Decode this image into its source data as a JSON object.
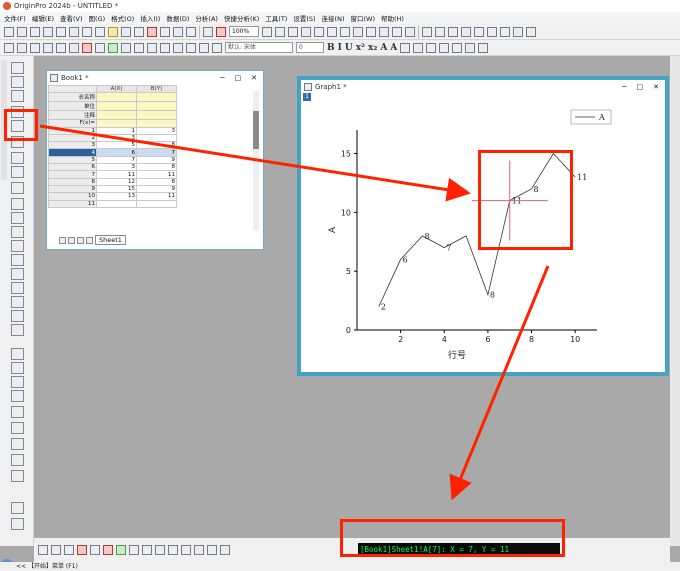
{
  "app": {
    "title": "OriginPro 2024b - UNTITLED *"
  },
  "menu": [
    "文件(F)",
    "编辑(E)",
    "查看(V)",
    "图(G)",
    "格式(O)",
    "插入(I)",
    "数据(D)",
    "分析(A)",
    "快捷分析(K)",
    "工具(T)",
    "设置(S)",
    "连接(N)",
    "窗口(W)",
    "帮助(H)"
  ],
  "toolbar": {
    "zoom": "100%",
    "font_placeholder": "默认: 宋体",
    "font_size": "0",
    "format_buttons": [
      "B",
      "I",
      "U",
      "x²",
      "x₂",
      "A",
      "A"
    ]
  },
  "book": {
    "title": "Book1 *",
    "sheet_tab": "Sheet1",
    "col_headers": [
      "",
      "A(X)",
      "B(Y)"
    ],
    "meta_rows": [
      "长名称",
      "单位",
      "注释",
      "F(x)="
    ],
    "rows": [
      {
        "n": "1",
        "a": "1",
        "b": "3"
      },
      {
        "n": "2",
        "a": "3",
        "b": ""
      },
      {
        "n": "3",
        "a": "5",
        "b": "8"
      },
      {
        "n": "4",
        "a": "6",
        "b": "7"
      },
      {
        "n": "5",
        "a": "7",
        "b": "9"
      },
      {
        "n": "6",
        "a": "3",
        "b": "8"
      },
      {
        "n": "7",
        "a": "11",
        "b": "11"
      },
      {
        "n": "8",
        "a": "12",
        "b": "8"
      },
      {
        "n": "9",
        "a": "15",
        "b": "9"
      },
      {
        "n": "10",
        "a": "13",
        "b": "11"
      },
      {
        "n": "11",
        "a": "",
        "b": ""
      }
    ],
    "selected_row": "4"
  },
  "graph": {
    "title": "Graph1 *",
    "layer_number": "1",
    "legend": "A",
    "xlabel": "行号",
    "ylabel": "A",
    "x_ticks": [
      "2",
      "4",
      "6",
      "8",
      "10"
    ],
    "y_ticks": [
      "0",
      "5",
      "10",
      "15"
    ]
  },
  "chart_data": {
    "type": "line",
    "x": [
      1,
      2,
      3,
      4,
      5,
      6,
      7,
      8,
      9,
      10
    ],
    "values": [
      2,
      6,
      8,
      7,
      8,
      3,
      11,
      12,
      15,
      13
    ],
    "point_labels": [
      "2",
      "6",
      "8",
      "7",
      "",
      "8",
      "11",
      "8",
      "",
      "11"
    ],
    "xlabel": "行号",
    "ylabel": "A",
    "xlim": [
      0,
      11
    ],
    "ylim": [
      0,
      17
    ],
    "legend": "top-right",
    "crosshair": {
      "x": 7,
      "y": 11
    }
  },
  "status": {
    "readout": "[Book1]Sheet1!A[7]:  X = 7, Y = 11",
    "bar": "<< 【开始】菜单 (F1)"
  }
}
